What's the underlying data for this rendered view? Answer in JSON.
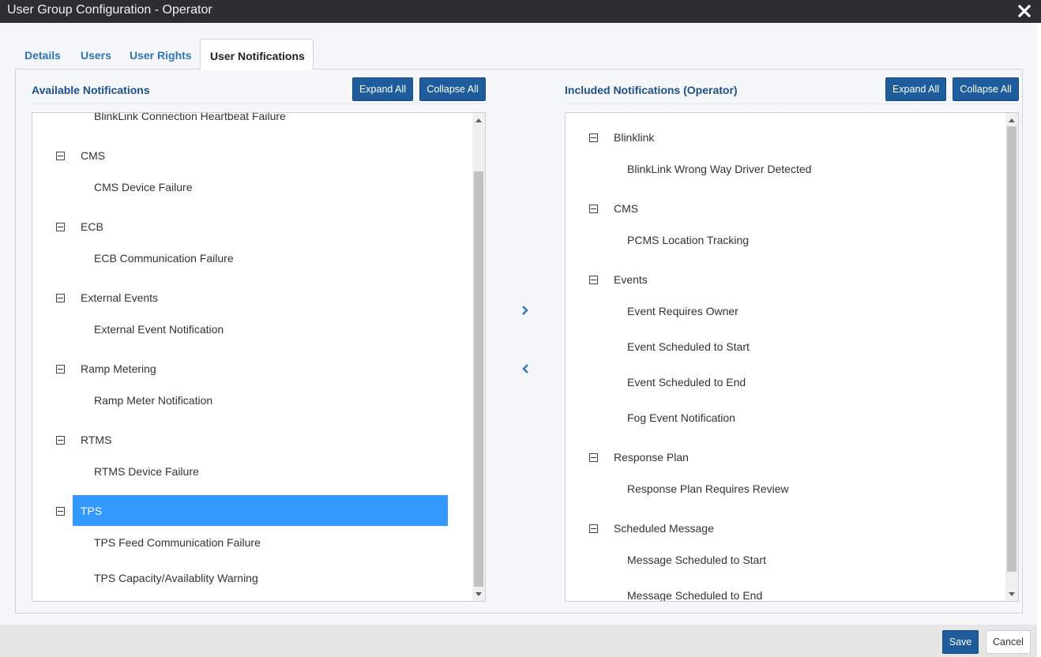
{
  "window": {
    "title": "User Group Configuration - Operator"
  },
  "tabs": [
    {
      "label": "Details"
    },
    {
      "label": "Users"
    },
    {
      "label": "User Rights"
    },
    {
      "label": "User Notifications"
    }
  ],
  "available": {
    "title": "Available Notifications",
    "expand_label": "Expand All",
    "collapse_label": "Collapse All",
    "partial_item": "BlinkLink Connection Heartbeat Failure",
    "groups": [
      {
        "label": "CMS",
        "items": [
          "CMS Device Failure"
        ]
      },
      {
        "label": "ECB",
        "items": [
          "ECB Communication Failure"
        ]
      },
      {
        "label": "External Events",
        "items": [
          "External Event Notification"
        ]
      },
      {
        "label": "Ramp Metering",
        "items": [
          "Ramp Meter Notification"
        ]
      },
      {
        "label": "RTMS",
        "items": [
          "RTMS Device Failure"
        ]
      },
      {
        "label": "TPS",
        "items": [
          "TPS Feed Communication Failure",
          "TPS Capacity/Availablity Warning"
        ]
      }
    ]
  },
  "included": {
    "title": "Included Notifications (Operator)",
    "expand_label": "Expand All",
    "collapse_label": "Collapse All",
    "groups": [
      {
        "label": "Blinklink",
        "items": [
          "BlinkLink Wrong Way Driver Detected"
        ]
      },
      {
        "label": "CMS",
        "items": [
          "PCMS Location Tracking"
        ]
      },
      {
        "label": "Events",
        "items": [
          "Event Requires Owner",
          "Event Scheduled to Start",
          "Event Scheduled to End",
          "Fog Event Notification"
        ]
      },
      {
        "label": "Response Plan",
        "items": [
          "Response Plan Requires Review"
        ]
      },
      {
        "label": "Scheduled Message",
        "items": [
          "Message Scheduled to Start",
          "Message Scheduled to End"
        ]
      }
    ]
  },
  "footer": {
    "save_label": "Save",
    "cancel_label": "Cancel"
  },
  "colors": {
    "accent": "#1f5c9c",
    "selection": "#3399ff",
    "titlebar": "#2b2e33",
    "link": "#2f74b5"
  }
}
